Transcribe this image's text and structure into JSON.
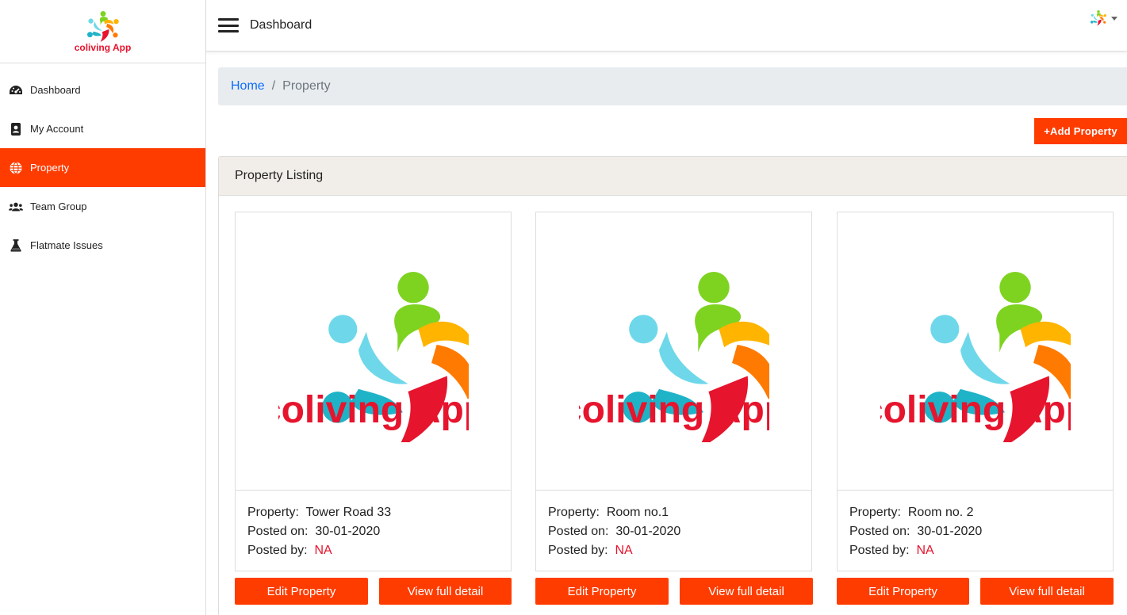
{
  "brand": {
    "name": "coliving App"
  },
  "sidebar": {
    "items": [
      {
        "label": "Dashboard",
        "icon": "tachometer-icon",
        "active": false
      },
      {
        "label": "My Account",
        "icon": "address-book-icon",
        "active": false
      },
      {
        "label": "Property",
        "icon": "globe-icon",
        "active": true
      },
      {
        "label": "Team Group",
        "icon": "users-icon",
        "active": false
      },
      {
        "label": "Flatmate Issues",
        "icon": "flask-icon",
        "active": false
      }
    ]
  },
  "topbar": {
    "title": "Dashboard",
    "user_logo_text": "coliving App"
  },
  "breadcrumb": {
    "home": "Home",
    "separator": "/",
    "current": "Property"
  },
  "actions": {
    "add_property": "+Add Property"
  },
  "listing": {
    "title": "Property Listing",
    "property_label": "Property:",
    "posted_on_label": "Posted on:",
    "posted_by_label": "Posted by:",
    "edit_label": "Edit Property",
    "view_label": "View full detail",
    "cards": [
      {
        "property": "Tower Road 33",
        "posted_on": "30-01-2020",
        "posted_by": "NA",
        "image_text": "coliving App"
      },
      {
        "property": "Room no.1",
        "posted_on": "30-01-2020",
        "posted_by": "NA",
        "image_text": "coliving App"
      },
      {
        "property": "Room no. 2",
        "posted_on": "30-01-2020",
        "posted_by": "NA",
        "image_text": "coliving App"
      }
    ]
  },
  "colors": {
    "accent": "#ff3c00",
    "brand_red": "#e6142d",
    "link": "#0d6efd",
    "breadcrumb_bg": "#e9ecef",
    "panel_header_bg": "#f1ede8"
  }
}
